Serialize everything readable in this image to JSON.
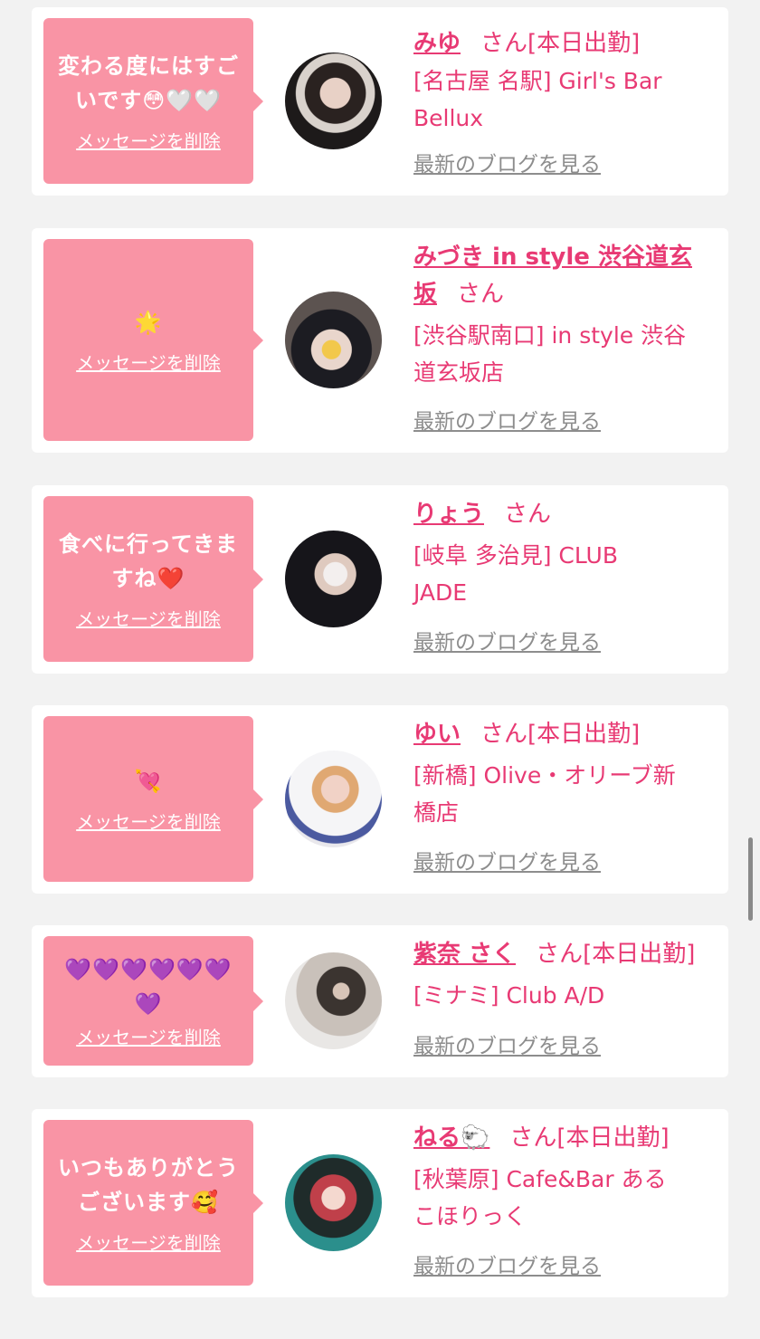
{
  "common": {
    "delete_label": "メッセージを削除",
    "blog_label": "最新のブログを見る"
  },
  "colors": {
    "background": "#f2f2f2",
    "bubble": "#f994a5",
    "accent": "#e83a74",
    "muted": "#8d8d8d"
  },
  "cards": [
    {
      "message_lines": [
        "変わる度にはすご",
        "いです😳🤍🤍"
      ],
      "name": "みゆ",
      "suffix": "さん[本日出勤]",
      "shop_lines": [
        "[名古屋 名駅] Girl's Bar",
        "Bellux"
      ]
    },
    {
      "message_lines": [
        "🌟"
      ],
      "name_lines": [
        "みづき in style 渋谷道玄",
        "坂"
      ],
      "suffix": "さん",
      "shop_lines": [
        "[渋谷駅南口] in style 渋谷",
        "道玄坂店"
      ]
    },
    {
      "message_lines": [
        "食べに行ってきま",
        "すね❤️"
      ],
      "name": "りょう",
      "suffix": "さん",
      "shop_lines": [
        "[岐阜 多治見] CLUB",
        "JADE"
      ]
    },
    {
      "message_lines": [
        "💘"
      ],
      "name": "ゆい",
      "suffix": "さん[本日出勤]",
      "shop_lines": [
        "[新橋] Olive・オリーブ新",
        "橋店"
      ]
    },
    {
      "message_lines": [
        "💜💜💜💜💜💜",
        "💜"
      ],
      "name": "紫奈 さく",
      "suffix": "さん[本日出勤]",
      "shop_lines": [
        "[ミナミ] Club A/D"
      ]
    },
    {
      "message_lines": [
        "いつもありがとう",
        "ございます🥰"
      ],
      "name": "ねる🐑",
      "suffix": "さん[本日出勤]",
      "shop_lines": [
        "[秋葉原] Cafe&Bar ある",
        "こほりっく"
      ]
    }
  ]
}
